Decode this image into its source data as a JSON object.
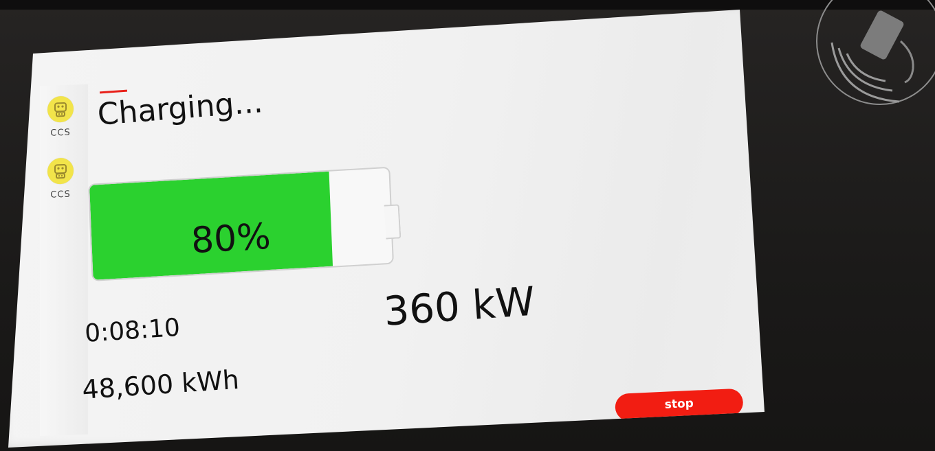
{
  "sidebar": {
    "connectors": [
      {
        "label": "CCS",
        "icon": "ccs-plug-icon"
      },
      {
        "label": "CCS",
        "icon": "ccs-plug-icon"
      }
    ]
  },
  "status": {
    "title": "Charging..."
  },
  "battery": {
    "percent_label": "80%",
    "fill_fraction": 0.8
  },
  "readouts": {
    "power": "360 kW",
    "elapsed_time": "0:08:10",
    "energy": "48,600 kWh"
  },
  "actions": {
    "stop_label": "stop"
  },
  "hardware": {
    "rfid_reader_icon": "rfid-card-tap-icon"
  },
  "colors": {
    "accent_red": "#e8211a",
    "stop_button": "#f21d12",
    "battery_green": "#2bd12f",
    "connector_yellow": "#f2e44a"
  }
}
